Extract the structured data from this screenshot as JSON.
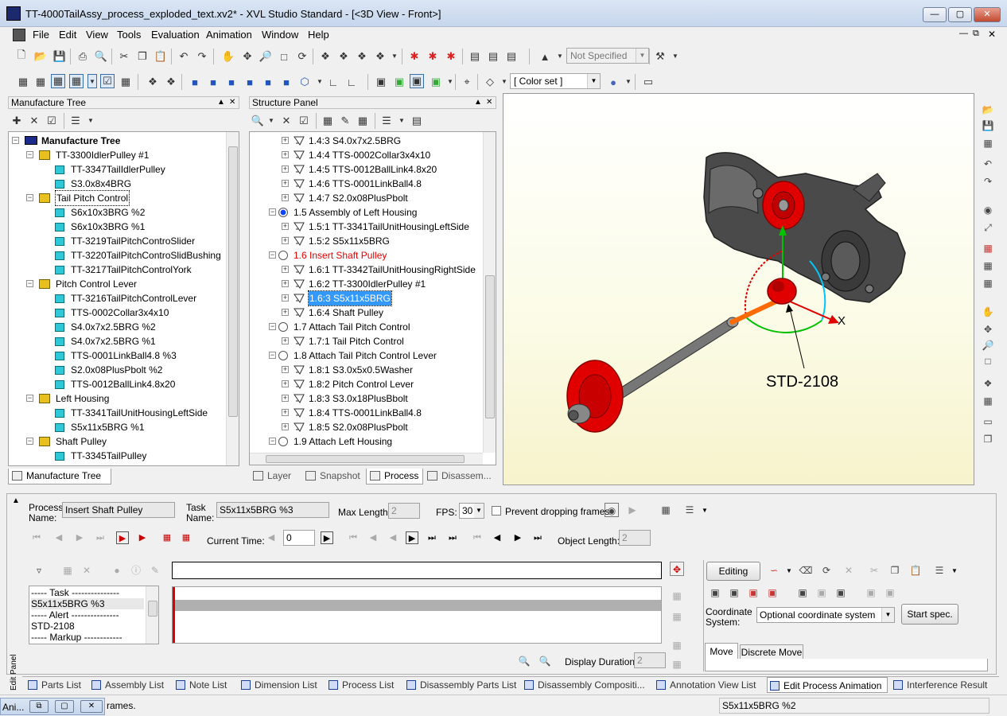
{
  "window": {
    "title": "TT-4000TailAssy_process_exploded_text.xv2* - XVL Studio Standard - [<3D View - Front>]"
  },
  "menu": [
    "File",
    "Edit",
    "View",
    "Tools",
    "Evaluation",
    "Animation",
    "Window",
    "Help"
  ],
  "toolbar": {
    "not_specified": "Not Specified",
    "color_set": "[ Color set ]"
  },
  "manufacture_panel": {
    "title": "Manufacture Tree",
    "tab_label": "Manufacture Tree",
    "root": "Manufacture Tree",
    "items": [
      {
        "label": "TT-3300IdlerPulley #1",
        "level": 1,
        "kind": "asm"
      },
      {
        "label": "TT-3347TailIdlerPulley",
        "level": 2,
        "kind": "part"
      },
      {
        "label": "S3.0x8x4BRG",
        "level": 2,
        "kind": "part"
      },
      {
        "label": "Tail Pitch Control",
        "level": 1,
        "kind": "asm",
        "boxed": true
      },
      {
        "label": "S6x10x3BRG %2",
        "level": 2,
        "kind": "part"
      },
      {
        "label": "S6x10x3BRG %1",
        "level": 2,
        "kind": "part"
      },
      {
        "label": "TT-3219TailPitchControSlider",
        "level": 2,
        "kind": "part"
      },
      {
        "label": "TT-3220TailPitchControSlidBushing",
        "level": 2,
        "kind": "part"
      },
      {
        "label": "TT-3217TailPitchControlYork",
        "level": 2,
        "kind": "part"
      },
      {
        "label": "Pitch Control Lever",
        "level": 1,
        "kind": "asm"
      },
      {
        "label": "TT-3216TailPitchControlLever",
        "level": 2,
        "kind": "part"
      },
      {
        "label": "TTS-0002Collar3x4x10",
        "level": 2,
        "kind": "part"
      },
      {
        "label": "S4.0x7x2.5BRG %2",
        "level": 2,
        "kind": "part"
      },
      {
        "label": "S4.0x7x2.5BRG %1",
        "level": 2,
        "kind": "part"
      },
      {
        "label": "TTS-0001LinkBall4.8 %3",
        "level": 2,
        "kind": "part"
      },
      {
        "label": "S2.0x08PlusPbolt %2",
        "level": 2,
        "kind": "part"
      },
      {
        "label": "TTS-0012BallLink4.8x20",
        "level": 2,
        "kind": "part"
      },
      {
        "label": "Left Housing",
        "level": 1,
        "kind": "asm"
      },
      {
        "label": "TT-3341TailUnitHousingLeftSide",
        "level": 2,
        "kind": "part"
      },
      {
        "label": "S5x11x5BRG %1",
        "level": 2,
        "kind": "part"
      },
      {
        "label": "Shaft Pulley",
        "level": 1,
        "kind": "asm"
      },
      {
        "label": "TT-3345TailPulley",
        "level": 2,
        "kind": "part"
      }
    ]
  },
  "structure_panel": {
    "title": "Structure Panel",
    "items": [
      {
        "label": "1.4:3 S4.0x7x2.5BRG",
        "level": 2
      },
      {
        "label": "1.4:4 TTS-0002Collar3x4x10",
        "level": 2
      },
      {
        "label": "1.4:5 TTS-0012BallLink4.8x20",
        "level": 2
      },
      {
        "label": "1.4:6 TTS-0001LinkBall4.8",
        "level": 2
      },
      {
        "label": "1.4:7 S2.0x08PlusPbolt",
        "level": 2
      },
      {
        "label": "1.5 Assembly of Left Housing",
        "level": 1,
        "radio": "on"
      },
      {
        "label": "1.5:1 TT-3341TailUnitHousingLeftSide",
        "level": 2
      },
      {
        "label": "1.5:2 S5x11x5BRG",
        "level": 2
      },
      {
        "label": "1.6 Insert Shaft Pulley",
        "level": 1,
        "radio": "off",
        "red": true
      },
      {
        "label": "1.6:1 TT-3342TailUnitHousingRightSide",
        "level": 2
      },
      {
        "label": "1.6:2 TT-3300IdlerPulley #1",
        "level": 2
      },
      {
        "label": "1.6:3 S5x11x5BRG",
        "level": 2,
        "selected": true
      },
      {
        "label": "1.6:4 Shaft Pulley",
        "level": 2
      },
      {
        "label": "1.7 Attach Tail Pitch Control",
        "level": 1,
        "radio": "off"
      },
      {
        "label": "1.7:1 Tail Pitch Control",
        "level": 2
      },
      {
        "label": "1.8 Attach Tail Pitch Control Lever",
        "level": 1,
        "radio": "off"
      },
      {
        "label": "1.8:1 S3.0x5x0.5Washer",
        "level": 2
      },
      {
        "label": "1.8:2 Pitch Control Lever",
        "level": 2
      },
      {
        "label": "1.8:3 S3.0x18PlusBbolt",
        "level": 2
      },
      {
        "label": "1.8:4 TTS-0001LinkBall4.8",
        "level": 2
      },
      {
        "label": "1.8:5 S2.0x08PlusPbolt",
        "level": 2
      },
      {
        "label": "1.9 Attach Left Housing",
        "level": 1,
        "radio": "off"
      }
    ],
    "tabs": [
      "Layer",
      "Snapshot",
      "Process",
      "Disassem..."
    ],
    "active_tab": "Process"
  },
  "viewport": {
    "annotation": "STD-2108",
    "axis_x": "X",
    "colors": {
      "part_red": "#e00000",
      "housing": "#4a4a4a",
      "axis_green": "#00c000",
      "axis_red": "#e00000",
      "axis_cyan": "#00c8ff",
      "axis_orange": "#ff6a00"
    }
  },
  "edit_panel": {
    "side_label": "Edit Panel",
    "process_name_label": "Process Name:",
    "process_name": "Insert Shaft Pulley",
    "task_name_label": "Task Name:",
    "task_name": "S5x11x5BRG %3",
    "max_length_label": "Max Length:",
    "max_length": "2",
    "fps_label": "FPS:",
    "fps": "30",
    "prevent_label": "Prevent dropping frames",
    "current_time_label": "Current Time:",
    "current_time": "0",
    "object_length_label": "Object Length:",
    "object_length": "2",
    "task_list": [
      "----- Task ---------------",
      "S5x11x5BRG %3",
      "----- Alert ---------------",
      "STD-2108",
      "----- Markup ------------"
    ],
    "display_duration_label": "Display Duration:",
    "display_duration": "2",
    "editing_label": "Editing",
    "coord_label": "Coordinate System:",
    "coord_value": "Optional coordinate system",
    "start_spec": "Start spec.",
    "move_tabs": [
      "Move",
      "Discrete Move"
    ]
  },
  "bottom_tabs": [
    "Parts List",
    "Assembly List",
    "Note List",
    "Dimension List",
    "Process List",
    "Disassembly Parts List",
    "Disassembly Compositi...",
    "Annotation View List",
    "Edit Process Animation",
    "Interference Result"
  ],
  "active_bottom_tab": "Edit Process Animation",
  "status": {
    "left": "Ani...",
    "message": "rames.",
    "right": "S5x11x5BRG %2"
  }
}
